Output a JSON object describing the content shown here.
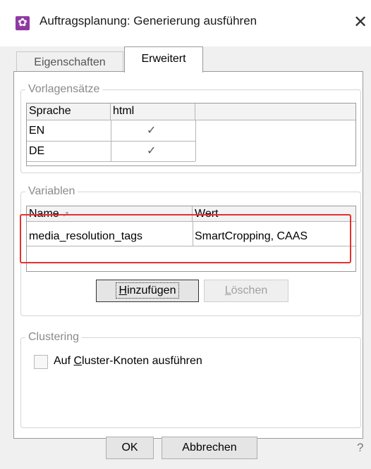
{
  "window": {
    "title": "Auftragsplanung: Generierung ausführen",
    "close_label": "✕",
    "app_icon_glyph": "✿"
  },
  "tabs": [
    {
      "label": "Eigenschaften",
      "active": false
    },
    {
      "label": "Erweitert",
      "active": true
    }
  ],
  "vorlagensaetze": {
    "legend": "Vorlagensätze",
    "columns": [
      "Sprache",
      "html"
    ],
    "rows": [
      {
        "language": "EN",
        "html_checked": true,
        "check_glyph": "✓"
      },
      {
        "language": "DE",
        "html_checked": true,
        "check_glyph": "✓"
      }
    ]
  },
  "variablen": {
    "legend": "Variablen",
    "columns": [
      "Name",
      "Wert"
    ],
    "sort_indicator": "↗",
    "rows": [
      {
        "name": "media_resolution_tags",
        "value": "SmartCropping, CAAS"
      }
    ],
    "add_button": {
      "pre": "",
      "accel": "H",
      "post": "inzufügen"
    },
    "delete_button": {
      "pre": "",
      "accel": "L",
      "post": "öschen"
    }
  },
  "clustering": {
    "legend": "Clustering",
    "checkbox": {
      "pre": "Auf ",
      "accel": "C",
      "post": "luster-Knoten ausführen",
      "checked": false
    }
  },
  "footer": {
    "ok_label": "OK",
    "cancel_label": "Abbrechen",
    "help_label": "?"
  },
  "colors": {
    "highlight_box": "#e53030",
    "app_icon": "#8e3aa2"
  }
}
